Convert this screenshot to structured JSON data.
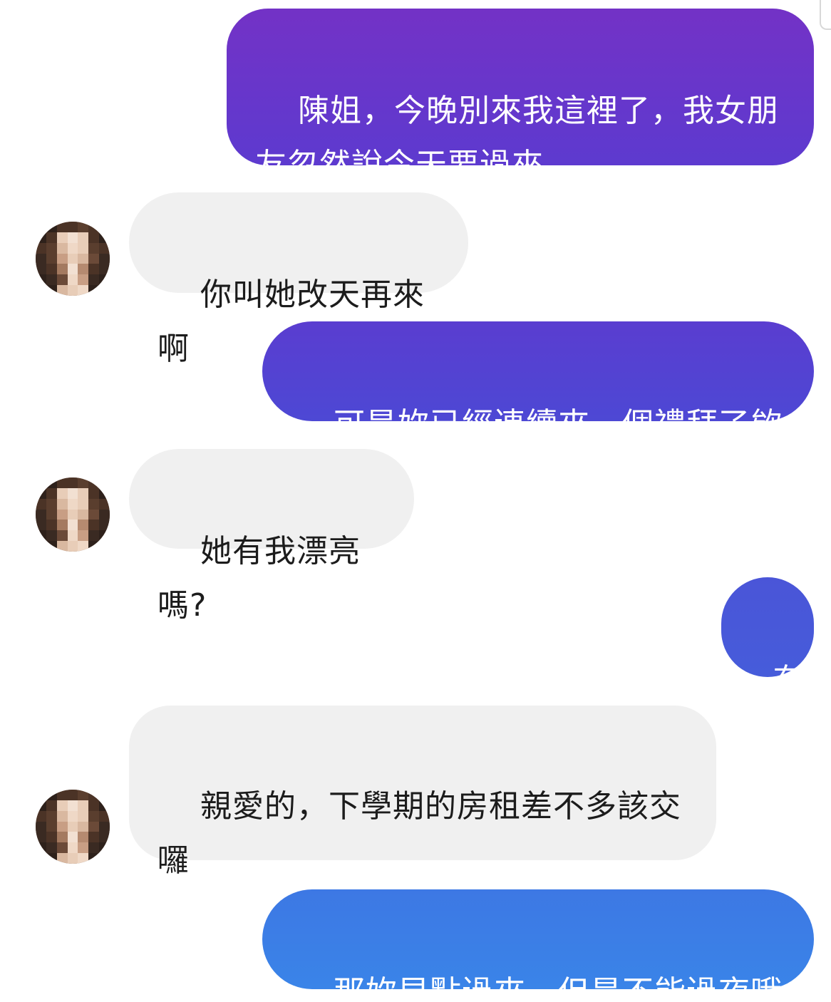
{
  "messages": [
    {
      "direction": "sent",
      "text": "陳姐，今晚別來我這裡了，我女朋友忽然說今天要過來",
      "color": "#6a30c8"
    },
    {
      "direction": "received",
      "text": "你叫她改天再來啊"
    },
    {
      "direction": "sent",
      "text": "可是妳已經連續來一個禮拜了欸",
      "color": "#5540cf"
    },
    {
      "direction": "received",
      "text": "她有我漂亮嗎?"
    },
    {
      "direction": "sent",
      "text": "有",
      "color": "#4659d8"
    },
    {
      "direction": "received",
      "text": "親愛的，下學期的房租差不多該交囉"
    },
    {
      "direction": "sent",
      "text": "那妳早點過來，但是不能過夜哦",
      "color": "#3b7fe6"
    }
  ],
  "colors": {
    "sent_gradient_top": "#7030c8",
    "sent_gradient_bottom": "#3b82e8",
    "received_bubble": "#f0f0f0",
    "received_text": "#1c1c1c"
  },
  "avatar": {
    "style": "pixelated"
  }
}
